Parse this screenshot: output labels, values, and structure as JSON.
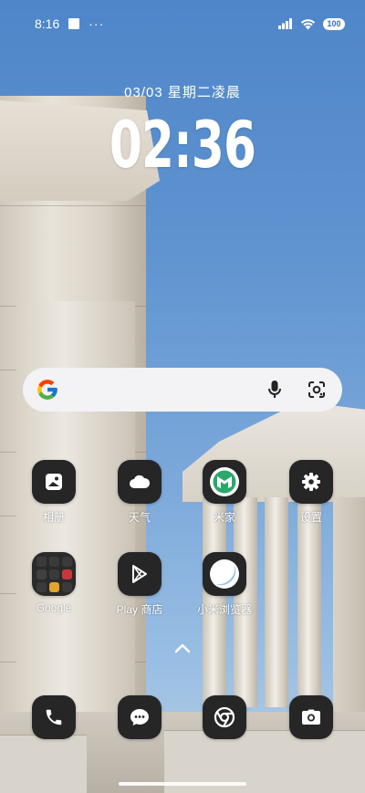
{
  "status_bar": {
    "time": "8:16",
    "dots": "···",
    "battery": "100"
  },
  "clock": {
    "date": "03/03  星期二凌晨",
    "time": "02:36"
  },
  "search_bar": {
    "logo": "google-g-icon",
    "mic": "mic-icon",
    "lens": "lens-icon"
  },
  "apps": {
    "row1": [
      {
        "label": "相册",
        "icon": "gallery-icon"
      },
      {
        "label": "天气",
        "icon": "weather-icon"
      },
      {
        "label": "米家",
        "icon": "mi-home-icon"
      },
      {
        "label": "设置",
        "icon": "settings-icon"
      }
    ],
    "row2": [
      {
        "label": "Google",
        "icon": "folder-icon"
      },
      {
        "label": "Play 商店",
        "icon": "play-store-icon"
      },
      {
        "label": "小米浏览器",
        "icon": "mi-browser-icon"
      }
    ]
  },
  "dock": [
    {
      "icon": "phone-icon"
    },
    {
      "icon": "messages-icon"
    },
    {
      "icon": "chrome-icon"
    },
    {
      "icon": "camera-icon"
    }
  ],
  "colors": {
    "icon_bg": "#262626",
    "sky_top": "#4f86c9",
    "sky_bottom": "#b8cde0",
    "mi_home_green": "#2aa869"
  }
}
